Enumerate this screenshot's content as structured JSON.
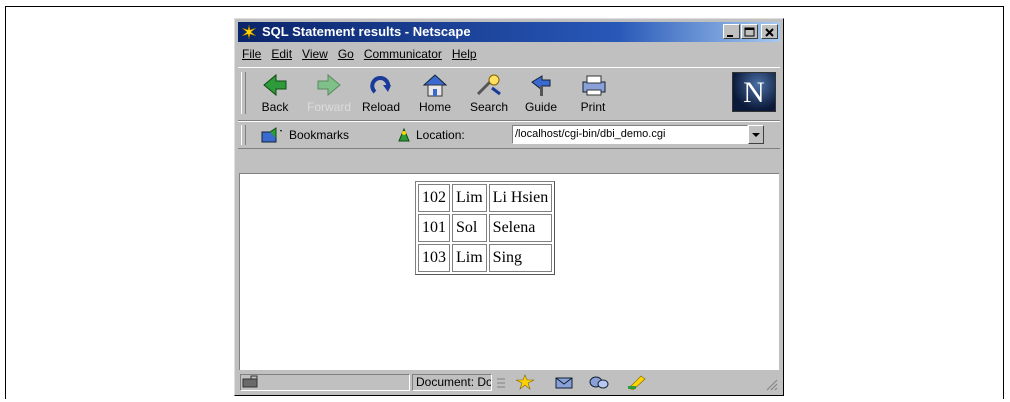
{
  "window": {
    "title": "SQL Statement results - Netscape"
  },
  "menu": [
    "File",
    "Edit",
    "View",
    "Go",
    "Communicator",
    "Help"
  ],
  "toolbar": {
    "buttons": [
      {
        "label": "Back",
        "icon": "back-arrow-icon",
        "enabled": true
      },
      {
        "label": "Forward",
        "icon": "forward-arrow-icon",
        "enabled": false
      },
      {
        "label": "Reload",
        "icon": "reload-icon",
        "enabled": true
      },
      {
        "label": "Home",
        "icon": "home-icon",
        "enabled": true
      },
      {
        "label": "Search",
        "icon": "search-icon",
        "enabled": true
      },
      {
        "label": "Guide",
        "icon": "guide-icon",
        "enabled": true
      },
      {
        "label": "Print",
        "icon": "print-icon",
        "enabled": true
      }
    ]
  },
  "location": {
    "bookmarks_label": "Bookmarks",
    "location_label": "Location:",
    "url": "/localhost/cgi-bin/dbi_demo.cgi"
  },
  "results": {
    "rows": [
      [
        "102",
        "Lim",
        "Li Hsien"
      ],
      [
        "101",
        "Sol",
        "Selena"
      ],
      [
        "103",
        "Lim",
        "Sing"
      ]
    ]
  },
  "status": {
    "text": "Document: Done"
  },
  "colors": {
    "titlebar": "#0a246a",
    "chrome": "#c0c0c0"
  }
}
